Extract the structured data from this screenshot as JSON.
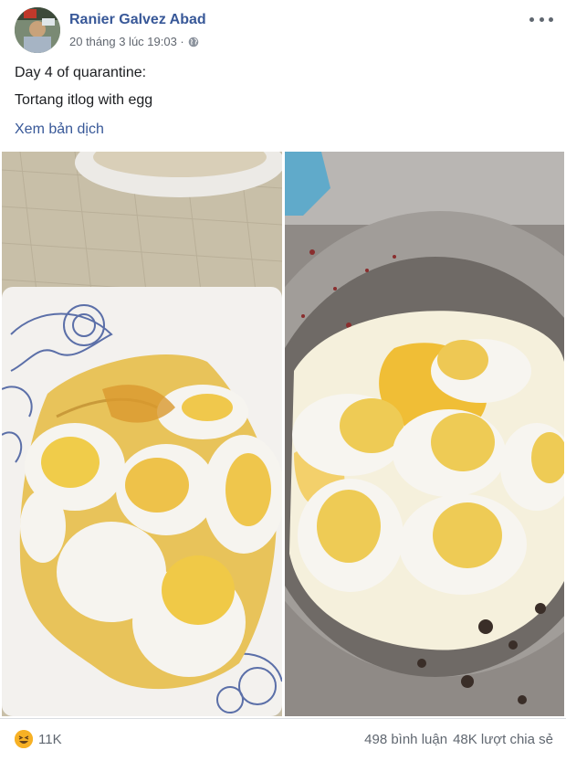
{
  "post": {
    "author": "Ranier Galvez Abad",
    "timestamp": "20 tháng 3 lúc 19:03 ·",
    "privacy_icon": "globe-icon",
    "lines": [
      "Day 4 of quarantine:",
      "Tortang itlog with egg"
    ],
    "translate_link": "Xem bản dịch"
  },
  "photos": [
    {
      "subject": "sliced boiled eggs with omelette on a plate"
    },
    {
      "subject": "eggs frying in a pan"
    }
  ],
  "footer": {
    "reaction_icon": "haha-icon",
    "reaction_count": "11K",
    "comments": "498 bình luận",
    "shares": "48K lượt chia sẻ"
  },
  "colors": {
    "link": "#385898",
    "secondary_text": "#616770",
    "text": "#1c1e21"
  }
}
